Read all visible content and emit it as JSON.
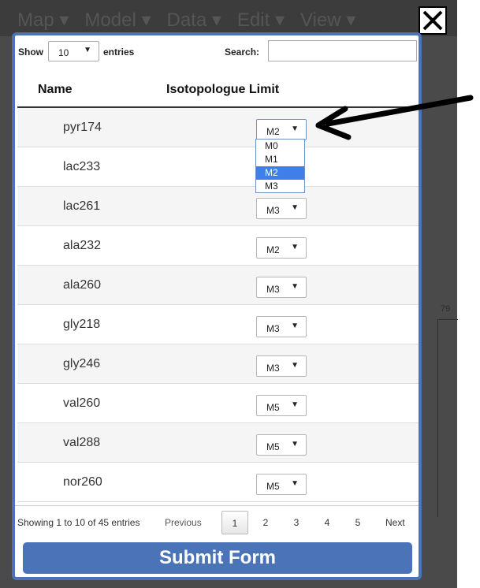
{
  "background_menu": [
    "Map ▾",
    "Model ▾",
    "Data ▾",
    "Edit ▾",
    "View ▾"
  ],
  "background_label": "79",
  "toolbar": {
    "show_label": "Show",
    "page_size": "10",
    "entries_label": "entries",
    "search_label": "Search:",
    "search_value": ""
  },
  "table": {
    "headers": [
      "Name",
      "Isotopologue Limit"
    ],
    "rows": [
      {
        "name": "pyr174",
        "limit": "M2"
      },
      {
        "name": "lac233",
        "limit": ""
      },
      {
        "name": "lac261",
        "limit": "M3"
      },
      {
        "name": "ala232",
        "limit": "M2"
      },
      {
        "name": "ala260",
        "limit": "M3"
      },
      {
        "name": "gly218",
        "limit": "M3"
      },
      {
        "name": "gly246",
        "limit": "M3"
      },
      {
        "name": "val260",
        "limit": "M5"
      },
      {
        "name": "val288",
        "limit": "M5"
      },
      {
        "name": "nor260",
        "limit": "M5"
      }
    ],
    "open_dropdown_options": [
      "M0",
      "M1",
      "M2",
      "M3"
    ],
    "open_dropdown_selected": "M2"
  },
  "footer": {
    "info": "Showing 1 to 10 of 45 entries",
    "previous": "Previous",
    "pages": [
      "1",
      "2",
      "3",
      "4",
      "5"
    ],
    "current_page": "1",
    "next": "Next"
  },
  "submit_label": "Submit Form",
  "colors": {
    "accent": "#4a73b8",
    "highlight": "#3f7fe8"
  },
  "icons": {
    "close": "close-icon",
    "annotation": "arrow-annotation-icon"
  }
}
